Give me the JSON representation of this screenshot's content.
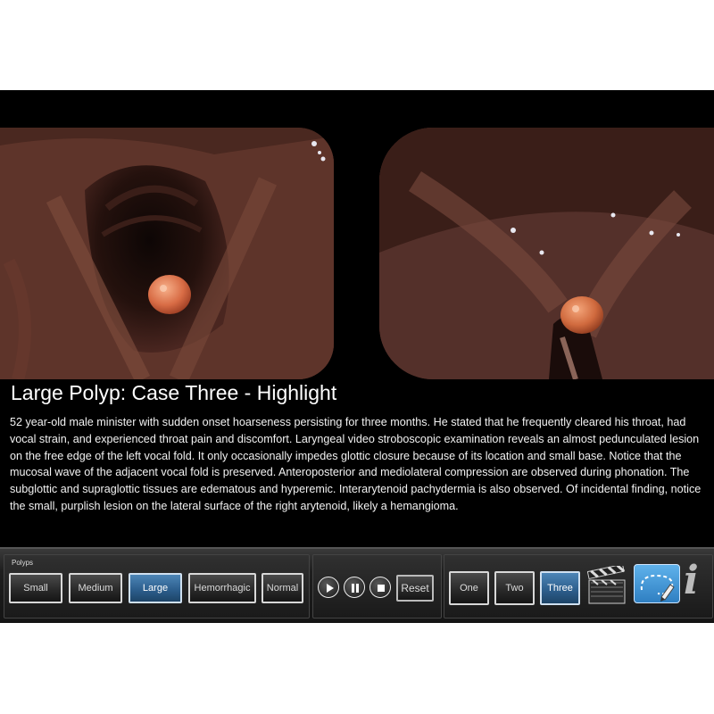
{
  "case": {
    "title": "Large Polyp: Case Three - Highlight",
    "description": "52 year-old male minister with sudden onset hoarseness persisting for three months. He stated that he frequently cleared his throat, had vocal strain, and experienced throat pain and discomfort. Laryngeal video stroboscopic examination reveals an almost pedunculated lesion on the free edge of the left vocal fold. It only occasionally impedes glottic closure because of its location and small base. Notice that the mucosal wave of the adjacent vocal fold is preserved. Anteroposterior and mediolateral compression are observed during phonation. The subglottic and supraglottic tissues are edematous and hyperemic. Interarytenoid pachydermia is also observed. Of incidental finding, notice the small, purplish lesion on the lateral surface of the right arytenoid, likely a hemangioma."
  },
  "images": {
    "left": {
      "icon": "endoscopy-view-open-glottis"
    },
    "right": {
      "icon": "endoscopy-view-closed-glottis"
    }
  },
  "toolbar": {
    "polyps_label": "Polyps",
    "polyp_types": [
      {
        "label": "Small",
        "active": false
      },
      {
        "label": "Medium",
        "active": false
      },
      {
        "label": "Large",
        "active": true
      },
      {
        "label": "Hemorrhagic",
        "active": false
      },
      {
        "label": "Normal",
        "active": false
      }
    ],
    "playback": {
      "play_icon": "play-icon",
      "pause_icon": "pause-icon",
      "stop_icon": "stop-icon",
      "reset_label": "Reset"
    },
    "cases": [
      {
        "label": "One",
        "active": false
      },
      {
        "label": "Two",
        "active": false
      },
      {
        "label": "Three",
        "active": true
      }
    ],
    "icons": [
      "clapperboard-icon",
      "draw-annotation-icon",
      "info-icon"
    ]
  },
  "colors": {
    "active_button": "#2d5f8e",
    "background": "#000000",
    "toolbar": "#1e1e1e"
  }
}
